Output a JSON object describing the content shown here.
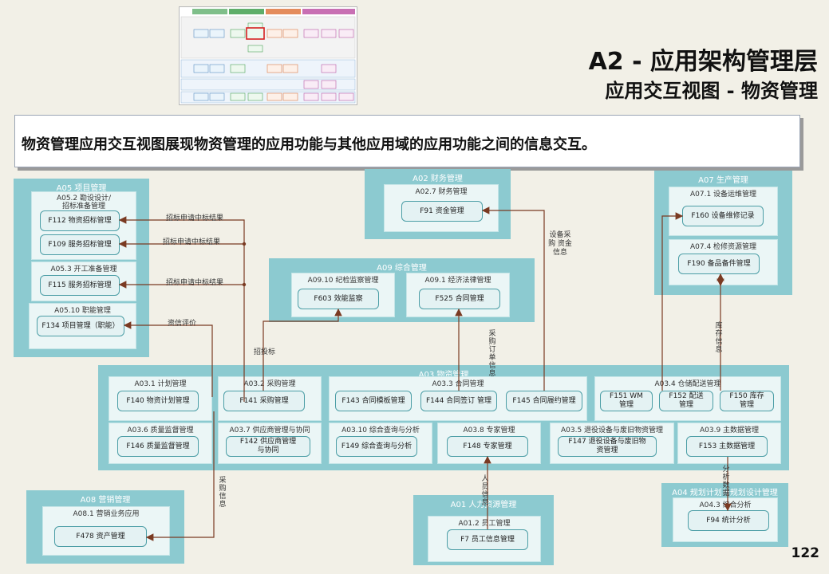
{
  "header": {
    "title": "A2 - 应用架构管理层",
    "subtitle": "应用交互视图 - 物资管理"
  },
  "banner": {
    "text": "物资管理应用交互视图展现物资管理的应用功能与其他应用域的应用功能之间的信息交互。"
  },
  "page_number": "122",
  "domains": {
    "a05": {
      "title": "A05 项目管理",
      "subs": {
        "s052": "A05.2 勘设设计/招标准备管理",
        "s053": "A05.3 开工准备管理",
        "s0510": "A05.10 职能管理"
      },
      "funcs": {
        "f112": "F112 物资招标管理",
        "f109": "F109 服务招标管理",
        "f115": "F115 服务招标管理",
        "f134": "F134 项目管理（职能）"
      }
    },
    "a02": {
      "title": "A02 财务管理",
      "subs": {
        "s027": "A02.7 财务管理"
      },
      "funcs": {
        "f91": "F91 资金管理"
      }
    },
    "a07": {
      "title": "A07 生产管理",
      "subs": {
        "s071": "A07.1 设备运维管理",
        "s074": "A07.4 检修资源管理"
      },
      "funcs": {
        "f160": "F160 设备维修记录",
        "f190": "F190 备品备件管理"
      }
    },
    "a09": {
      "title": "A09 综合管理",
      "subs": {
        "s0910": "A09.10 纪检监察管理",
        "s091": "A09.1 经济法律管理"
      },
      "funcs": {
        "f603": "F603 效能监察",
        "f525": "F525 合同管理"
      }
    },
    "a03": {
      "title": "A03 物资管理",
      "subs": {
        "s031": "A03.1 计划管理",
        "s032": "A03.2 采购管理",
        "s033": "A03.3 合同管理",
        "s034": "A03.4 仓储配送管理",
        "s036": "A03.6 质量监督管理",
        "s037": "A03.7 供应商管理与协同",
        "s0310": "A03.10 综合查询与分析",
        "s038": "A03.8 专家管理",
        "s035": "A03.5 退役设备与废旧物资管理",
        "s039": "A03.9 主数据管理"
      },
      "funcs": {
        "f140": "F140 物资计划管理",
        "f141": "F141 采购管理",
        "f143": "F143 合同模板管理",
        "f144": "F144 合同签订 管理",
        "f145": "F145 合同履约管理",
        "f151": "F151 WM管理",
        "f152": "F152 配送管理",
        "f150": "F150 库存管理",
        "f146": "F146 质量监督管理",
        "f142": "F142 供应商管理与协同",
        "f149": "F149 综合查询与分析",
        "f148": "F148 专家管理",
        "f147": "F147 退役设备与废旧物资管理",
        "f153": "F153 主数据管理"
      }
    },
    "a08": {
      "title": "A08 营销管理",
      "subs": {
        "s081": "A08.1 营销业务应用"
      },
      "funcs": {
        "f478": "F478 资产管理"
      }
    },
    "a01": {
      "title": "A01 人力资源管理",
      "subs": {
        "s012": "A01.2 员工管理"
      },
      "funcs": {
        "f7": "F7 员工信息管理"
      }
    },
    "a04": {
      "title": "A04 规划计划与规划设计管理",
      "subs": {
        "s043": "A04.3 综合分析"
      },
      "funcs": {
        "f94": "F94 统计分析"
      }
    }
  },
  "flows": {
    "bid1": "招标申请中标结果",
    "bid2": "招标申请中标结果",
    "bid3": "招标申请中标结果",
    "credit": "资信评价",
    "tender": "招投标",
    "payment": "设备采购 资金信息",
    "purchase_order": "采购订单信息",
    "inventory": "库存信息",
    "procure_info": "采购信息",
    "staff": "人员信息",
    "analysis": "分析数据"
  }
}
